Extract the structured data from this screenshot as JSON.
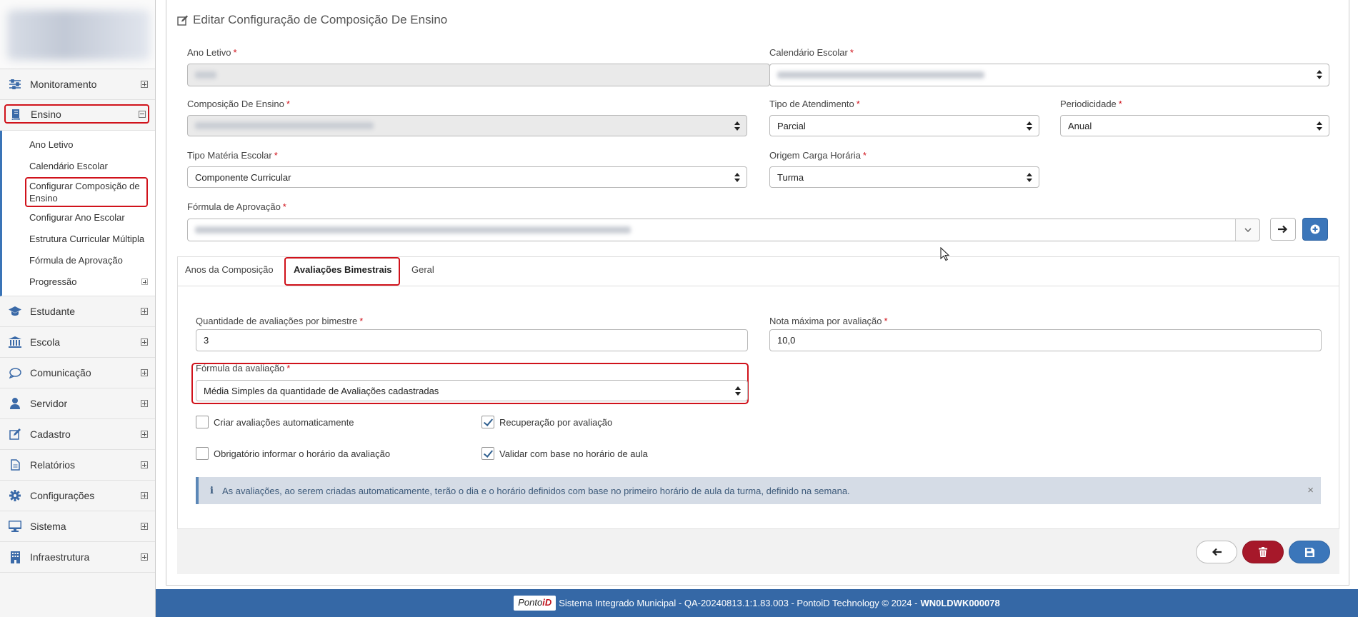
{
  "sidebar": {
    "items_top": [
      {
        "label": "Monitoramento",
        "icon": "sliders-icon"
      }
    ],
    "ensino": {
      "label": "Ensino",
      "icon": "book-icon"
    },
    "submenu": [
      "Ano Letivo",
      "Calendário Escolar",
      "Configurar Composição de Ensino",
      "Configurar Ano Escolar",
      "Estrutura Curricular Múltipla",
      "Fórmula de Aprovação",
      "Progressão"
    ],
    "items_bottom": [
      {
        "label": "Estudante",
        "icon": "graduation-cap-icon"
      },
      {
        "label": "Escola",
        "icon": "bank-icon"
      },
      {
        "label": "Comunicação",
        "icon": "chat-icon"
      },
      {
        "label": "Servidor",
        "icon": "user-icon"
      },
      {
        "label": "Cadastro",
        "icon": "edit-icon"
      },
      {
        "label": "Relatórios",
        "icon": "document-icon"
      },
      {
        "label": "Configurações",
        "icon": "gear-icon"
      },
      {
        "label": "Sistema",
        "icon": "monitor-icon"
      },
      {
        "label": "Infraestrutura",
        "icon": "building-icon"
      }
    ]
  },
  "page": {
    "title": "Editar Configuração de Composição De Ensino"
  },
  "form": {
    "ano_letivo": {
      "label": "Ano Letivo",
      "required": "*"
    },
    "calendario": {
      "label": "Calendário Escolar",
      "required": "*"
    },
    "composicao": {
      "label": "Composição De Ensino",
      "required": "*"
    },
    "tipo_atendimento": {
      "label": "Tipo de Atendimento",
      "required": "*",
      "value": "Parcial"
    },
    "periodicidade": {
      "label": "Periodicidade",
      "required": "*",
      "value": "Anual"
    },
    "tipo_materia": {
      "label": "Tipo Matéria Escolar",
      "required": "*",
      "value": "Componente Curricular"
    },
    "origem_carga": {
      "label": "Origem Carga Horária",
      "required": "*",
      "value": "Turma"
    },
    "formula_aprovacao": {
      "label": "Fórmula de Aprovação",
      "required": "*"
    }
  },
  "tabs": [
    {
      "label": "Anos da Composição",
      "active": false
    },
    {
      "label": "Avaliações Bimestrais",
      "active": true
    },
    {
      "label": "Geral",
      "active": false
    }
  ],
  "bimestrais": {
    "quantidade": {
      "label": "Quantidade de avaliações por bimestre",
      "required": "*",
      "value": "3"
    },
    "nota_maxima": {
      "label": "Nota máxima por avaliação",
      "required": "*",
      "value": "10,0"
    },
    "formula_avaliacao": {
      "label": "Fórmula da avaliação",
      "required": "*",
      "value": "Média Simples da quantidade de Avaliações cadastradas"
    },
    "checkboxes": [
      {
        "label": "Criar avaliações automaticamente",
        "checked": false
      },
      {
        "label": "Recuperação por avaliação",
        "checked": true
      },
      {
        "label": "Obrigatório informar o horário da avaliação",
        "checked": false
      },
      {
        "label": "Validar com base no horário de aula",
        "checked": true
      }
    ],
    "alert": "As avaliações, ao serem criadas automaticamente, terão o dia e o horário definidos com base no primeiro horário de aula da turma, definido na semana."
  },
  "footer": {
    "logo_a": "Ponto",
    "logo_b": "iD",
    "text": "Sistema Integrado Municipal - QA-20240813.1:1.83.003 - PontoiD Technology © 2024 - ",
    "machine": "WN0LDWK000078"
  },
  "colors": {
    "primary": "#3b76ba",
    "danger": "#a6182a",
    "highlight": "#d0121b",
    "footer": "#3568a6"
  }
}
